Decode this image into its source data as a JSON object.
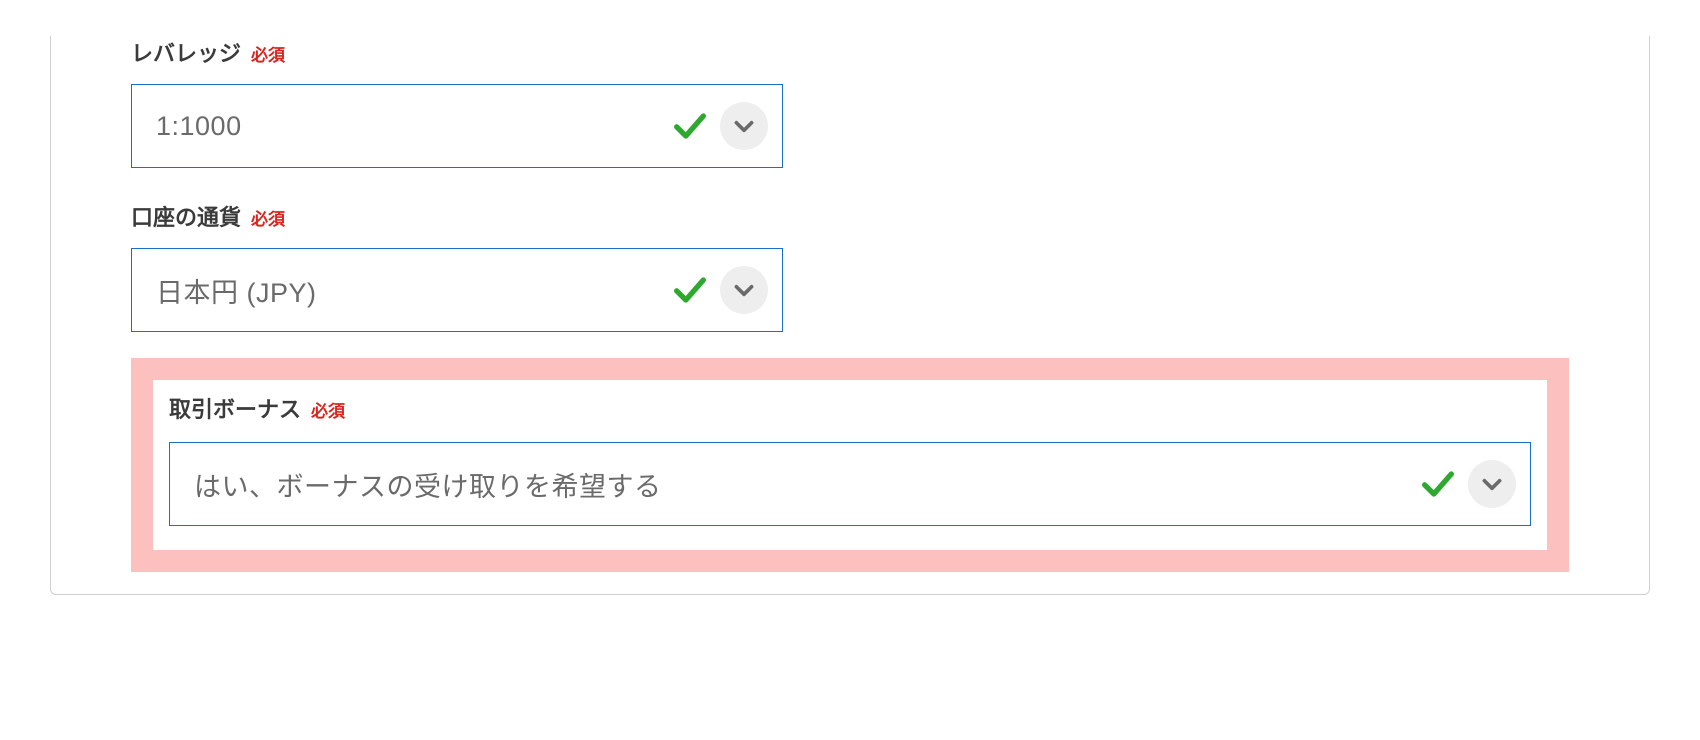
{
  "fields": {
    "leverage": {
      "label": "レバレッジ",
      "required": "必須",
      "value": "1:1000"
    },
    "currency": {
      "label": "口座の通貨",
      "required": "必須",
      "value": "日本円 (JPY)"
    },
    "bonus": {
      "label": "取引ボーナス",
      "required": "必須",
      "value": "はい、ボーナスの受け取りを希望する"
    }
  }
}
